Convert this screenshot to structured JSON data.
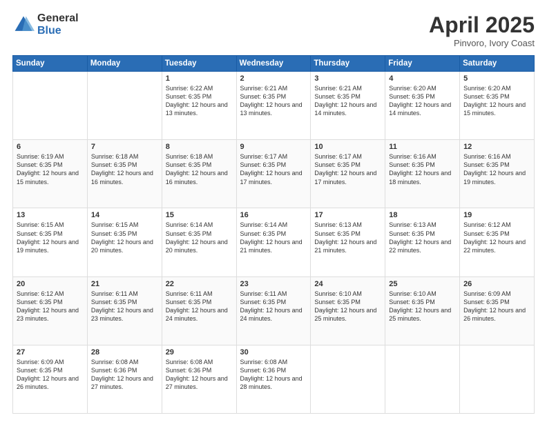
{
  "header": {
    "logo_general": "General",
    "logo_blue": "Blue",
    "title": "April 2025",
    "subtitle": "Pinvoro, Ivory Coast"
  },
  "weekdays": [
    "Sunday",
    "Monday",
    "Tuesday",
    "Wednesday",
    "Thursday",
    "Friday",
    "Saturday"
  ],
  "weeks": [
    [
      {
        "day": "",
        "info": ""
      },
      {
        "day": "",
        "info": ""
      },
      {
        "day": "1",
        "info": "Sunrise: 6:22 AM\nSunset: 6:35 PM\nDaylight: 12 hours and 13 minutes."
      },
      {
        "day": "2",
        "info": "Sunrise: 6:21 AM\nSunset: 6:35 PM\nDaylight: 12 hours and 13 minutes."
      },
      {
        "day": "3",
        "info": "Sunrise: 6:21 AM\nSunset: 6:35 PM\nDaylight: 12 hours and 14 minutes."
      },
      {
        "day": "4",
        "info": "Sunrise: 6:20 AM\nSunset: 6:35 PM\nDaylight: 12 hours and 14 minutes."
      },
      {
        "day": "5",
        "info": "Sunrise: 6:20 AM\nSunset: 6:35 PM\nDaylight: 12 hours and 15 minutes."
      }
    ],
    [
      {
        "day": "6",
        "info": "Sunrise: 6:19 AM\nSunset: 6:35 PM\nDaylight: 12 hours and 15 minutes."
      },
      {
        "day": "7",
        "info": "Sunrise: 6:18 AM\nSunset: 6:35 PM\nDaylight: 12 hours and 16 minutes."
      },
      {
        "day": "8",
        "info": "Sunrise: 6:18 AM\nSunset: 6:35 PM\nDaylight: 12 hours and 16 minutes."
      },
      {
        "day": "9",
        "info": "Sunrise: 6:17 AM\nSunset: 6:35 PM\nDaylight: 12 hours and 17 minutes."
      },
      {
        "day": "10",
        "info": "Sunrise: 6:17 AM\nSunset: 6:35 PM\nDaylight: 12 hours and 17 minutes."
      },
      {
        "day": "11",
        "info": "Sunrise: 6:16 AM\nSunset: 6:35 PM\nDaylight: 12 hours and 18 minutes."
      },
      {
        "day": "12",
        "info": "Sunrise: 6:16 AM\nSunset: 6:35 PM\nDaylight: 12 hours and 19 minutes."
      }
    ],
    [
      {
        "day": "13",
        "info": "Sunrise: 6:15 AM\nSunset: 6:35 PM\nDaylight: 12 hours and 19 minutes."
      },
      {
        "day": "14",
        "info": "Sunrise: 6:15 AM\nSunset: 6:35 PM\nDaylight: 12 hours and 20 minutes."
      },
      {
        "day": "15",
        "info": "Sunrise: 6:14 AM\nSunset: 6:35 PM\nDaylight: 12 hours and 20 minutes."
      },
      {
        "day": "16",
        "info": "Sunrise: 6:14 AM\nSunset: 6:35 PM\nDaylight: 12 hours and 21 minutes."
      },
      {
        "day": "17",
        "info": "Sunrise: 6:13 AM\nSunset: 6:35 PM\nDaylight: 12 hours and 21 minutes."
      },
      {
        "day": "18",
        "info": "Sunrise: 6:13 AM\nSunset: 6:35 PM\nDaylight: 12 hours and 22 minutes."
      },
      {
        "day": "19",
        "info": "Sunrise: 6:12 AM\nSunset: 6:35 PM\nDaylight: 12 hours and 22 minutes."
      }
    ],
    [
      {
        "day": "20",
        "info": "Sunrise: 6:12 AM\nSunset: 6:35 PM\nDaylight: 12 hours and 23 minutes."
      },
      {
        "day": "21",
        "info": "Sunrise: 6:11 AM\nSunset: 6:35 PM\nDaylight: 12 hours and 23 minutes."
      },
      {
        "day": "22",
        "info": "Sunrise: 6:11 AM\nSunset: 6:35 PM\nDaylight: 12 hours and 24 minutes."
      },
      {
        "day": "23",
        "info": "Sunrise: 6:11 AM\nSunset: 6:35 PM\nDaylight: 12 hours and 24 minutes."
      },
      {
        "day": "24",
        "info": "Sunrise: 6:10 AM\nSunset: 6:35 PM\nDaylight: 12 hours and 25 minutes."
      },
      {
        "day": "25",
        "info": "Sunrise: 6:10 AM\nSunset: 6:35 PM\nDaylight: 12 hours and 25 minutes."
      },
      {
        "day": "26",
        "info": "Sunrise: 6:09 AM\nSunset: 6:35 PM\nDaylight: 12 hours and 26 minutes."
      }
    ],
    [
      {
        "day": "27",
        "info": "Sunrise: 6:09 AM\nSunset: 6:35 PM\nDaylight: 12 hours and 26 minutes."
      },
      {
        "day": "28",
        "info": "Sunrise: 6:08 AM\nSunset: 6:36 PM\nDaylight: 12 hours and 27 minutes."
      },
      {
        "day": "29",
        "info": "Sunrise: 6:08 AM\nSunset: 6:36 PM\nDaylight: 12 hours and 27 minutes."
      },
      {
        "day": "30",
        "info": "Sunrise: 6:08 AM\nSunset: 6:36 PM\nDaylight: 12 hours and 28 minutes."
      },
      {
        "day": "",
        "info": ""
      },
      {
        "day": "",
        "info": ""
      },
      {
        "day": "",
        "info": ""
      }
    ]
  ]
}
